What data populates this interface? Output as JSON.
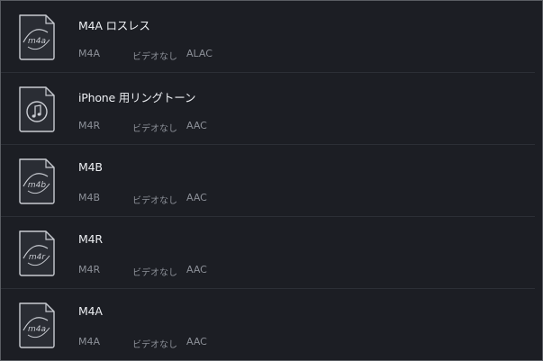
{
  "items": [
    {
      "title": "M4A ロスレス",
      "format": "M4A",
      "video": "ビデオなし",
      "codec": "ALAC",
      "icon": "m4a-file-icon",
      "badge": "m4a"
    },
    {
      "title": "iPhone 用リングトーン",
      "format": "M4R",
      "video": "ビデオなし",
      "codec": "AAC",
      "icon": "music-note-file-icon",
      "badge": ""
    },
    {
      "title": "M4B",
      "format": "M4B",
      "video": "ビデオなし",
      "codec": "AAC",
      "icon": "m4b-file-icon",
      "badge": "m4b"
    },
    {
      "title": "M4R",
      "format": "M4R",
      "video": "ビデオなし",
      "codec": "AAC",
      "icon": "m4r-file-icon",
      "badge": "m4r"
    },
    {
      "title": "M4A",
      "format": "M4A",
      "video": "ビデオなし",
      "codec": "AAC",
      "icon": "m4a-file-icon",
      "badge": "m4a"
    }
  ],
  "colors": {
    "background": "#1c1e24",
    "title": "#eceef2",
    "meta": "#8c9098",
    "icon_stroke": "#c9ccd2"
  }
}
